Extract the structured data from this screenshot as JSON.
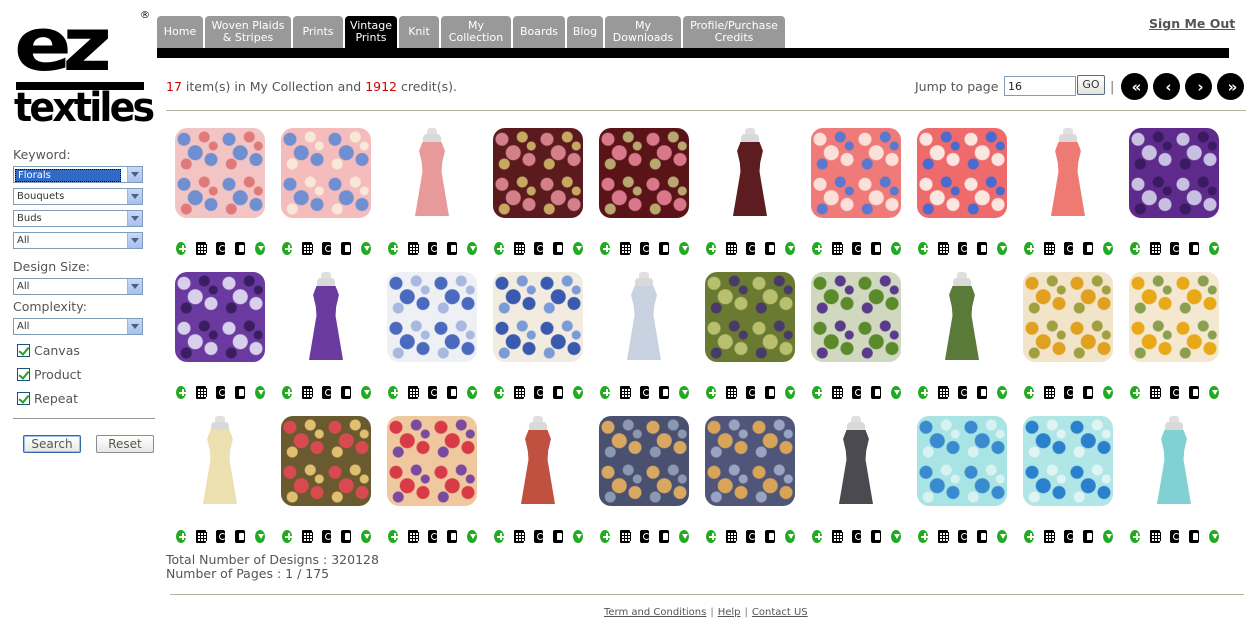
{
  "brand": {
    "logo_top": "ez",
    "logo_bottom": "textiles",
    "logo_reg": "®"
  },
  "sidebar": {
    "keyword_label": "Keyword:",
    "keyword_selects": [
      "Florals",
      "Bouquets",
      "Buds",
      "All"
    ],
    "design_size_label": "Design Size:",
    "design_size_value": "All",
    "complexity_label": "Complexity:",
    "complexity_value": "All",
    "checkboxes": [
      {
        "label": "Canvas",
        "checked": true
      },
      {
        "label": "Product",
        "checked": true
      },
      {
        "label": "Repeat",
        "checked": true
      }
    ],
    "search_label": "Search",
    "reset_label": "Reset"
  },
  "tabs": [
    {
      "label": "Home",
      "active": false
    },
    {
      "label": "Woven Plaids & Stripes",
      "active": false
    },
    {
      "label": "Prints",
      "active": false
    },
    {
      "label": "Vintage Prints",
      "active": true
    },
    {
      "label": "Knit",
      "active": false
    },
    {
      "label": "My Collection",
      "active": false
    },
    {
      "label": "Boards",
      "active": false
    },
    {
      "label": "Blog",
      "active": false
    },
    {
      "label": "My Downloads",
      "active": false
    },
    {
      "label": "Profile/Purchase Credits",
      "active": false
    }
  ],
  "header": {
    "sign_out": "Sign Me Out"
  },
  "status": {
    "items_count": "17",
    "items_text": " item(s) in My Collection and ",
    "credits_count": "1912",
    "credits_text": " credit(s)."
  },
  "pager": {
    "jump_label": "Jump to page",
    "page_value": "16",
    "go_label": "GO",
    "separator": "|",
    "first": "«",
    "prev": "‹",
    "next": "›",
    "last": "»"
  },
  "grid": {
    "rows": [
      [
        {
          "kind": "swatch",
          "bg": "#f2c4c4",
          "accent": "#6f8fd0",
          "accent2": "#e07a7a"
        },
        {
          "kind": "swatch",
          "bg": "#f4bcbc",
          "accent": "#6f8fd0",
          "accent2": "#f7e8d8"
        },
        {
          "kind": "dress",
          "bg": "#e89a9a"
        },
        {
          "kind": "swatch",
          "bg": "#5a1a1e",
          "accent": "#d4808a",
          "accent2": "#c6a860"
        },
        {
          "kind": "swatch",
          "bg": "#5a1418",
          "accent": "#d8788a",
          "accent2": "#b8a870"
        },
        {
          "kind": "dress",
          "bg": "#5c1c20"
        },
        {
          "kind": "swatch",
          "bg": "#f07a78",
          "accent": "#fbe0da",
          "accent2": "#5a78d0"
        },
        {
          "kind": "swatch",
          "bg": "#ef6a6a",
          "accent": "#fbe6e0",
          "accent2": "#4a6ad0"
        },
        {
          "kind": "dress",
          "bg": "#ee7a74"
        },
        {
          "kind": "swatch",
          "bg": "#5e2a8c",
          "accent": "#c8c0e0",
          "accent2": "#3a1a60"
        }
      ],
      [
        {
          "kind": "swatch",
          "bg": "#6a3aa0",
          "accent": "#d8d0ea",
          "accent2": "#3a1e60"
        },
        {
          "kind": "dress",
          "bg": "#6a3aa0"
        },
        {
          "kind": "swatch",
          "bg": "#eef0f4",
          "accent": "#4a6ac0",
          "accent2": "#a8b8e0"
        },
        {
          "kind": "swatch",
          "bg": "#f2ece0",
          "accent": "#3a5ab0",
          "accent2": "#7a9ad8"
        },
        {
          "kind": "dress",
          "bg": "#c8d2e0"
        },
        {
          "kind": "swatch",
          "bg": "#6a7a30",
          "accent": "#b8c070",
          "accent2": "#4a3a6a"
        },
        {
          "kind": "swatch",
          "bg": "#d0d8c0",
          "accent": "#5a8a2a",
          "accent2": "#5a3a8a"
        },
        {
          "kind": "dress",
          "bg": "#5a7a3a"
        },
        {
          "kind": "swatch",
          "bg": "#f2e4c8",
          "accent": "#e0a020",
          "accent2": "#a0a040"
        },
        {
          "kind": "swatch",
          "bg": "#f4e8d0",
          "accent": "#e8a818",
          "accent2": "#8aa050"
        }
      ],
      [
        {
          "kind": "dress",
          "bg": "#ece0b0"
        },
        {
          "kind": "swatch",
          "bg": "#6a5a30",
          "accent": "#d84a50",
          "accent2": "#e0c070"
        },
        {
          "kind": "swatch",
          "bg": "#f0c8a0",
          "accent": "#d83a48",
          "accent2": "#7a4aa0"
        },
        {
          "kind": "dress",
          "bg": "#c05040"
        },
        {
          "kind": "swatch",
          "bg": "#4a5070",
          "accent": "#d8a860",
          "accent2": "#8a98b0"
        },
        {
          "kind": "swatch",
          "bg": "#50567a",
          "accent": "#d8a458",
          "accent2": "#9aa4c0"
        },
        {
          "kind": "dress",
          "bg": "#4a4a50"
        },
        {
          "kind": "swatch",
          "bg": "#a8e4e4",
          "accent": "#3a8ad0",
          "accent2": "#d8f2f2"
        },
        {
          "kind": "swatch",
          "bg": "#b0e6e6",
          "accent": "#2a80cc",
          "accent2": "#e0f4f4"
        },
        {
          "kind": "dress",
          "bg": "#80d0d4"
        }
      ]
    ],
    "actions": [
      "add-icon",
      "grid-icon",
      "cycle-icon",
      "shirt-icon",
      "download-icon"
    ]
  },
  "totals": {
    "designs": "Total Number of Designs : 320128",
    "pages": "Number of Pages : 1 / 175"
  },
  "footer": {
    "terms": "Term and Conditions",
    "help": "Help",
    "contact": "Contact US",
    "sep": "|"
  }
}
